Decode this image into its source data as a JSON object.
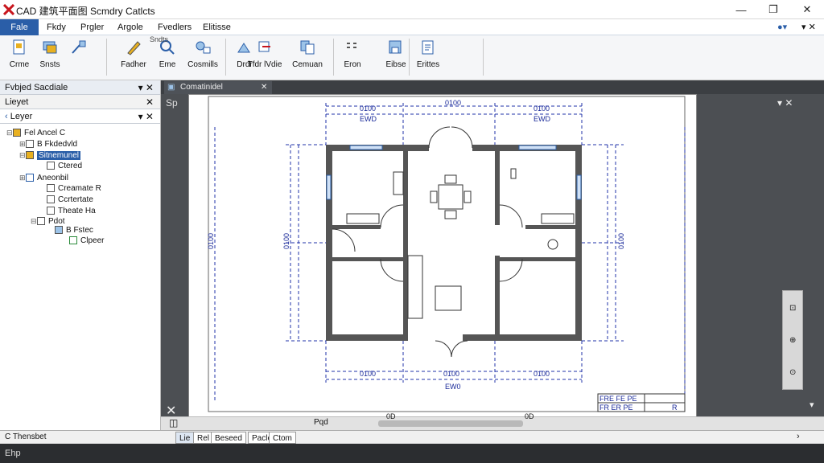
{
  "window": {
    "title": "CAD 建筑平面图 Scmdry Catlcts",
    "min": "—",
    "max": "❐",
    "close": "✕"
  },
  "menu": {
    "items": [
      "Fale",
      "Fkdy",
      "Prgler",
      "Argole",
      "Fvedlers",
      "Elitisse"
    ],
    "help": "?"
  },
  "ribbon": {
    "buttons": [
      {
        "label": "Crme",
        "icon": "new-file-icon"
      },
      {
        "label": "Snsts",
        "icon": "layers-icon"
      },
      {
        "label": "Fadher",
        "icon": "pencil-icon"
      },
      {
        "label": "Eme",
        "icon": "search-icon"
      },
      {
        "label": "Cosmills",
        "icon": "zoom-icon"
      },
      {
        "label": "Drdr",
        "icon": "draw-icon"
      },
      {
        "label": "Tfdr lVdie",
        "icon": "move-icon"
      },
      {
        "label": "Cemuan",
        "icon": "copy-icon"
      },
      {
        "label": "Eron",
        "icon": "grid-icon"
      },
      {
        "label": "Eibse",
        "icon": "save-icon"
      },
      {
        "label": "Erittes",
        "icon": "print-icon"
      }
    ],
    "group_label": "Sndts"
  },
  "left_panel": {
    "title": "Fvbjed Sacdiale",
    "subpanel_title": "Lieyet",
    "filter_label": "Leyer",
    "tree": [
      {
        "label": "Fel Ancel C",
        "level": 0
      },
      {
        "label": "B Fkdedvld",
        "level": 1
      },
      {
        "label": "Sitnemunel",
        "level": 1,
        "selected": true
      },
      {
        "label": "Ctered",
        "level": 2
      },
      {
        "label": "Aneonbil",
        "level": 1
      },
      {
        "label": "Creamate R",
        "level": 2
      },
      {
        "label": "Ccrtertate",
        "level": 2
      },
      {
        "label": "Theate Ha",
        "level": 2
      },
      {
        "label": "Pdot",
        "level": 1
      },
      {
        "label": "B Fstec",
        "level": 2
      },
      {
        "label": "Clpeer",
        "level": 3
      }
    ]
  },
  "document": {
    "tab_label": "Comatinidel",
    "sheet_label": "Sp",
    "dim_labels": {
      "top_a": "0100",
      "top_b": "0100",
      "top_c": "EWD",
      "top_d": "EWD",
      "bottom_a": "0100",
      "bottom_b": "0100",
      "bottom_c": "0100",
      "bottom_total": "EW0",
      "side": "0100",
      "left_mid": "0100",
      "right_mid": "0100"
    },
    "title_block": [
      "FRE FE PE",
      "FR ER PE",
      "R"
    ],
    "scale_marks": [
      "0D",
      "0D",
      "Pqd"
    ]
  },
  "layout_tabs": [
    "Lie",
    "Rel",
    "Beseed",
    "Pacle",
    "Ctom"
  ],
  "command_line": "C Thensbet",
  "status": "Ehp"
}
